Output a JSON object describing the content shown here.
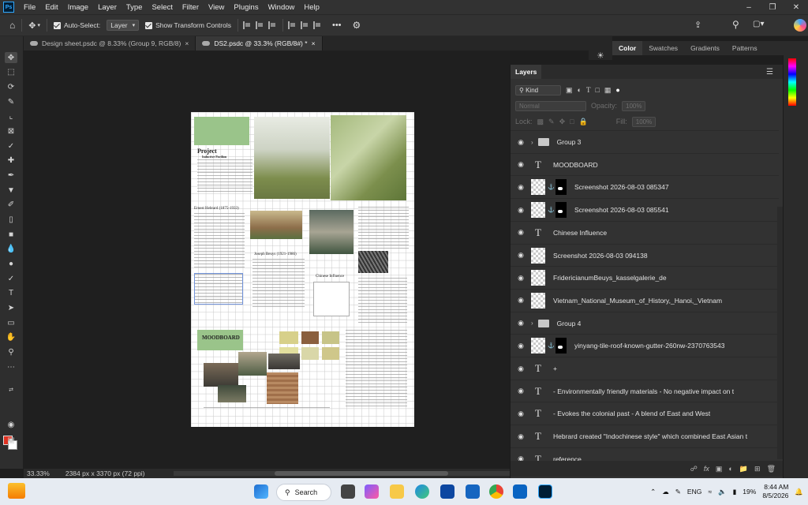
{
  "menubar": {
    "logo": "Ps",
    "items": [
      "File",
      "Edit",
      "Image",
      "Layer",
      "Type",
      "Select",
      "Filter",
      "View",
      "Plugins",
      "Window",
      "Help"
    ]
  },
  "options": {
    "auto_select_label": "Auto-Select:",
    "auto_select_value": "Layer",
    "show_transform_label": "Show Transform Controls",
    "more": "•••"
  },
  "tabs": [
    {
      "label": "Design sheet.psdc @ 8.33% (Group 9, RGB/8)",
      "close": "×"
    },
    {
      "label": "DS2.psdc @ 33.3% (RGB/8#) *",
      "close": "×"
    }
  ],
  "color_panel": {
    "tabs": [
      "Color",
      "Swatches",
      "Gradients",
      "Patterns"
    ]
  },
  "layers_panel": {
    "title": "Layers",
    "filter_kind": "Kind",
    "blend_mode": "Normal",
    "opacity_label": "Opacity:",
    "opacity_value": "100%",
    "lock_label": "Lock:",
    "fill_label": "Fill:",
    "fill_value": "100%",
    "layers": [
      {
        "type": "group",
        "name": "Group 3"
      },
      {
        "type": "text",
        "name": "MOODBOARD"
      },
      {
        "type": "masked",
        "name": "Screenshot 2026-08-03 085347"
      },
      {
        "type": "masked",
        "name": "Screenshot 2026-08-03 085541"
      },
      {
        "type": "text",
        "name": "Chinese Influence"
      },
      {
        "type": "image",
        "name": "Screenshot 2026-08-03 094138"
      },
      {
        "type": "image",
        "name": "FridericianumBeuys_kasselgalerie_de"
      },
      {
        "type": "image",
        "name": "Vietnam_National_Museum_of_History,_Hanoi,_Vietnam"
      },
      {
        "type": "group",
        "name": "Group 4"
      },
      {
        "type": "masked",
        "name": "yinyang-tile-roof-known-gutter-260nw-2370763543"
      },
      {
        "type": "text",
        "name": "+"
      },
      {
        "type": "text",
        "name": "- Environmentally friendly materials - No negative impact on t"
      },
      {
        "type": "text",
        "name": "- Evokes the colonial past - A blend of East and West"
      },
      {
        "type": "text",
        "name": "Hebrard created \"Indochinese style\" which combined East Asian t"
      },
      {
        "type": "text",
        "name": "reference"
      }
    ]
  },
  "document": {
    "project_title": "Project",
    "project_subtitle": "Inductive Pavilion",
    "ernest_heading": "Ernest Hebrard (1875-1933)",
    "joseph_heading": "Joseph Beuys (1921-1986)",
    "chinese_heading": "Chinese Influence",
    "moodboard": "MOODBOARD"
  },
  "status": {
    "zoom": "33.33%",
    "doc_info": "2384 px x 3370 px (72 ppi)"
  },
  "taskbar": {
    "search_label": "Search",
    "lang": "ENG",
    "battery": "19%",
    "time": "8:44 AM",
    "date": "8/5/2026"
  }
}
